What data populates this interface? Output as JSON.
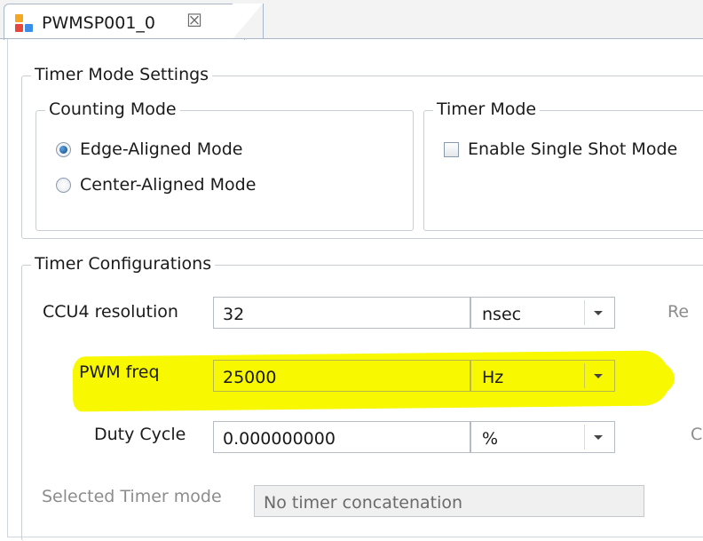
{
  "tab": {
    "title": "PWMSP001_0",
    "close_glyph": "☒",
    "icon_colors": [
      "#f5a623",
      "#e8453c",
      "#3c8de8",
      "#1e5fbf"
    ]
  },
  "timer_mode_settings": {
    "legend": "Timer Mode Settings",
    "counting_mode": {
      "legend": "Counting Mode",
      "options": [
        {
          "label": "Edge-Aligned Mode",
          "selected": true
        },
        {
          "label": "Center-Aligned Mode",
          "selected": false
        }
      ]
    },
    "timer_mode": {
      "legend": "Timer Mode",
      "single_shot_label": "Enable Single Shot Mode",
      "single_shot_checked": false
    }
  },
  "timer_configurations": {
    "legend": "Timer Configurations",
    "ccu4_resolution": {
      "label": "CCU4 resolution",
      "value": "32",
      "unit": "nsec"
    },
    "pwm_freq": {
      "label": "PWM freq",
      "value": "25000",
      "unit": "Hz"
    },
    "duty_cycle": {
      "label": "Duty Cycle",
      "value": "0.000000000",
      "unit": "%"
    },
    "selected_timer_mode": {
      "label": "Selected Timer mode",
      "value": "No timer concatenation"
    },
    "side_labels": {
      "resolution_side": "Re",
      "duty_side": "C"
    }
  },
  "colors": {
    "highlight": "#f8f800",
    "border": "#c9cfd5",
    "radio_checked": "#1e5a96"
  }
}
